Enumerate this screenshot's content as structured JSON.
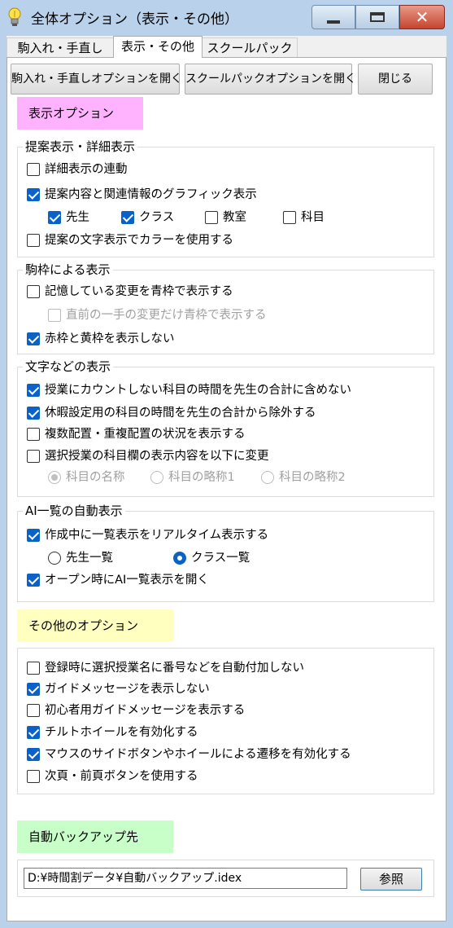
{
  "window": {
    "title": "全体オプション（表示・その他）",
    "close_glyph": "✕"
  },
  "tabs": [
    {
      "label": "駒入れ・手直し"
    },
    {
      "label": "表示・その他"
    },
    {
      "label": "スクールパック"
    }
  ],
  "toolbar": {
    "open_koma_label": "駒入れ・手直しオプションを開く",
    "open_school_label": "スクールパックオプションを開く",
    "close_label": "閉じる"
  },
  "display_options": {
    "section_label": "表示オプション",
    "accent_color": "#ffb3ff",
    "proposal_group": {
      "title": "提案表示・詳細表示",
      "detail_link": "詳細表示の連動",
      "graphic_display": "提案内容と関連情報のグラフィック表示",
      "sub_teacher": "先生",
      "sub_class": "クラス",
      "sub_room": "教室",
      "sub_subject": "科目",
      "color_text": "提案の文字表示でカラーを使用する"
    },
    "frame_group": {
      "title": "駒枠による表示",
      "remember_changes": "記憶している変更を青枠で表示する",
      "last_move_only": "直前の一手の変更だけ青枠で表示する",
      "hide_red_yellow": "赤枠と黄枠を表示しない"
    },
    "text_group": {
      "title": "文字などの表示",
      "exclude_uncounted": "授業にカウントしない科目の時間を先生の合計に含めない",
      "exclude_leave": "休暇設定用の科目の時間を先生の合計から除外する",
      "show_multi": "複数配置・重複配置の状況を表示する",
      "change_elective": "選択授業の科目欄の表示内容を以下に変更",
      "opt_name": "科目の名称",
      "opt_abbr1": "科目の略称1",
      "opt_abbr2": "科目の略称2"
    },
    "ai_group": {
      "title": "AI一覧の自動表示",
      "realtime": "作成中に一覧表示をリアルタイム表示する",
      "opt_teacher": "先生一覧",
      "opt_class": "クラス一覧",
      "open_on_start": "オープン時にAI一覧表示を開く"
    }
  },
  "other_options": {
    "section_label": "その他のオプション",
    "accent_color": "#ffffc0",
    "items": [
      "登録時に選択授業名に番号などを自動付加しない",
      "ガイドメッセージを表示しない",
      "初心者用ガイドメッセージを表示する",
      "チルトホイールを有効化する",
      "マウスのサイドボタンやホイールによる遷移を有効化する",
      "次頁・前頁ボタンを使用する"
    ]
  },
  "backup": {
    "section_label": "自動バックアップ先",
    "accent_color": "#c8ffc8",
    "path_value": "D:¥時間割データ¥自動バックアップ.idex",
    "browse_label": "参照"
  }
}
